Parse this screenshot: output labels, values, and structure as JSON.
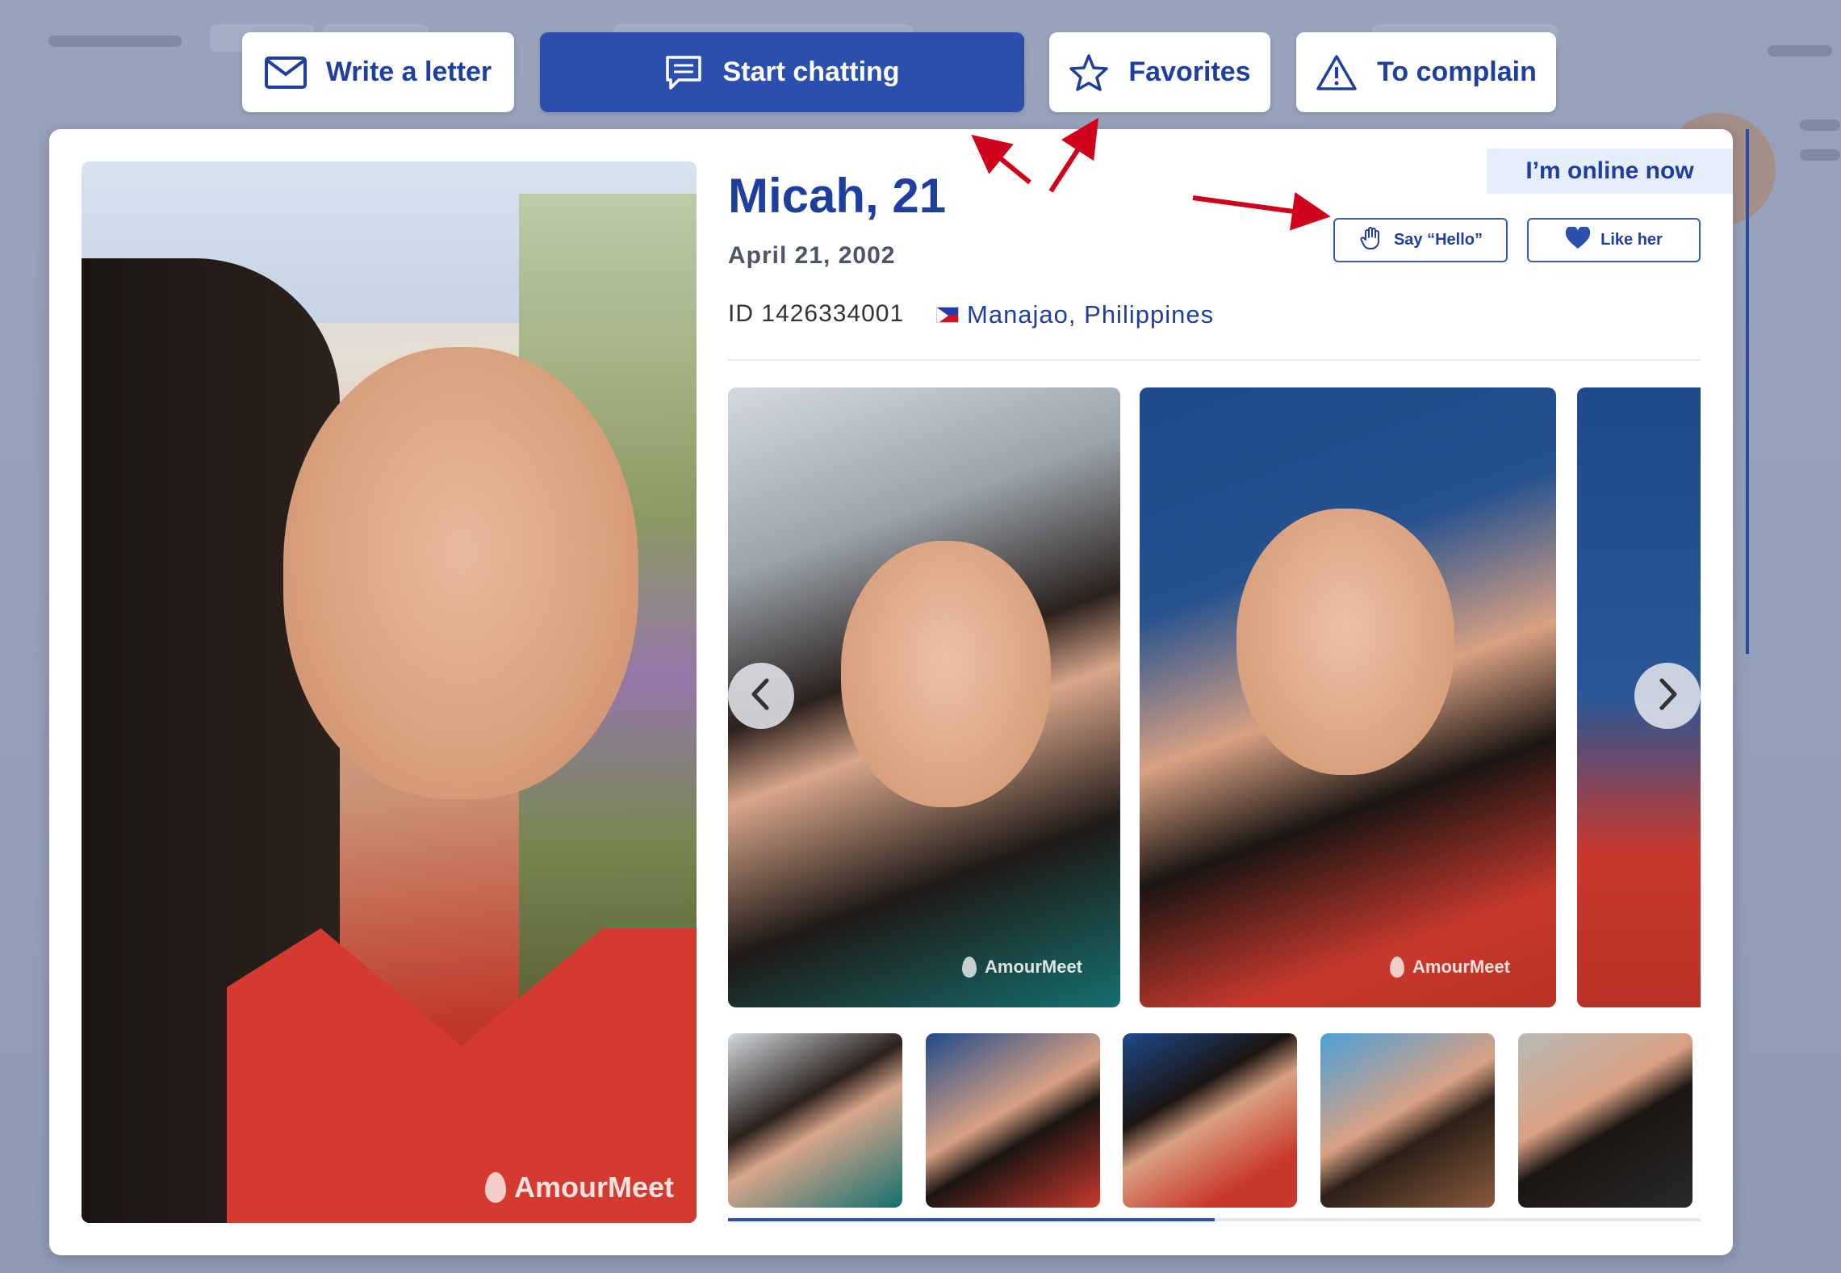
{
  "toolbar": {
    "write_letter": "Write a letter",
    "start_chatting": "Start chatting",
    "favorites": "Favorites",
    "complain": "To complain"
  },
  "profile": {
    "name_age": "Micah, 21",
    "birth_date": "April 21, 2002",
    "id": "ID 1426334001",
    "location": "Manajao, Philippines",
    "online_status": "I’m online now",
    "say_hello": "Say “Hello”",
    "like": "Like her"
  },
  "watermark": "AmourMeet",
  "gallery": {
    "progress": 0.5
  },
  "colors": {
    "brand_blue": "#1f3f9f",
    "button_blue": "#2a4fac",
    "annotation_red": "#d0021b"
  },
  "icons": {
    "write_letter": "envelope-icon",
    "start_chatting": "chat-bubble-icon",
    "favorites": "star-icon",
    "complain": "warning-icon",
    "say_hello": "wave-hand-icon",
    "like": "heart-icon"
  }
}
